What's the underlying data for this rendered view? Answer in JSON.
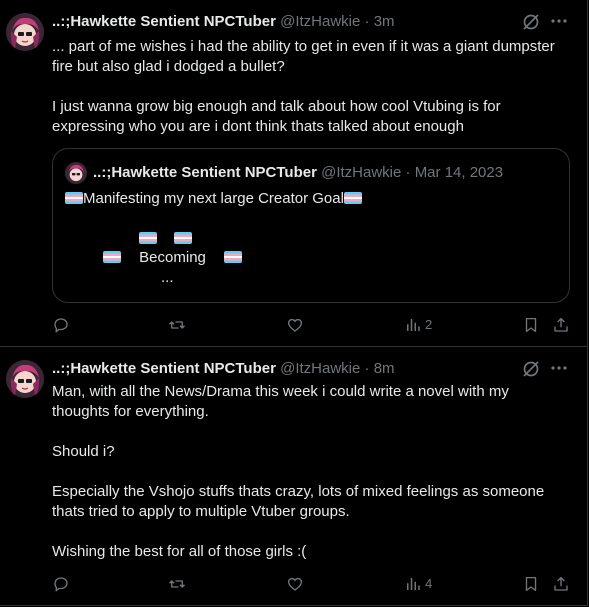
{
  "tweets": [
    {
      "author_name": "..:;Hawkette Sentient NPCTuber",
      "handle": "@ItzHawkie",
      "separator": "·",
      "time": "3m",
      "text": "... part of me wishes i had the ability to get in even if it was a giant dumpster\nfire but also glad i dodged a bullet?\n\nI just wanna grow big enough and talk about how cool Vtubing is for\nexpressing who you are i dont think thats talked about enough",
      "quote": {
        "author_name": "..:;Hawkette Sentient NPCTuber",
        "handle": "@ItzHawkie",
        "separator": "·",
        "date": "Mar 14, 2023",
        "line1": "Manifesting my next large Creator Goal",
        "line3": "Becoming",
        "line4": "..."
      },
      "views": "2"
    },
    {
      "author_name": "..:;Hawkette Sentient NPCTuber",
      "handle": "@ItzHawkie",
      "separator": "·",
      "time": "8m",
      "text": "Man, with all the News/Drama this week i could write a novel with my\nthoughts for everything.\n\nShould i?\n\nEspecially the Vshojo stuffs thats crazy, lots of mixed feelings as someone\nthats tried to apply to multiple Vtuber groups.\n\nWishing the best for all of those girls :(",
      "views": "4"
    }
  ],
  "icons": {
    "reply": "reply-icon",
    "repost": "repost-icon",
    "like": "like-icon",
    "views": "views-icon",
    "bookmark": "bookmark-icon",
    "share": "share-icon",
    "grok": "grok-icon",
    "more": "more-icon",
    "flag": "transgender-flag-emoji"
  },
  "colors": {
    "background": "#000000",
    "text": "#e7e9ea",
    "secondary": "#71767b",
    "border": "#2f3336"
  }
}
